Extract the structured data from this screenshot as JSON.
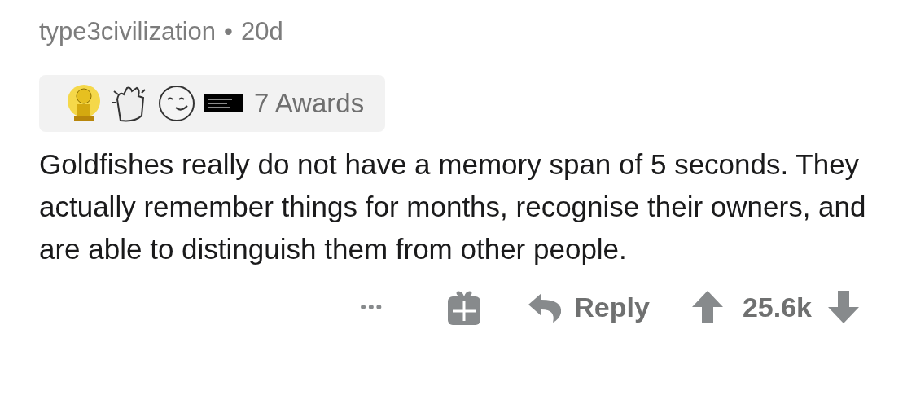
{
  "comment": {
    "author": "type3civilization",
    "separator": "•",
    "age": "20d"
  },
  "awards": {
    "icons": [
      {
        "kind": "trophy"
      },
      {
        "kind": "clap"
      },
      {
        "kind": "seal"
      },
      {
        "kind": "banner"
      }
    ],
    "count": "7 Awards"
  },
  "body": "Goldfishes really do not have a memory span of 5 seconds. They actually remember things for months, recognise their owners, and are able to distinguish them from other people.",
  "actions": {
    "more": "•••",
    "reply": "Reply",
    "score": "25.6k"
  }
}
